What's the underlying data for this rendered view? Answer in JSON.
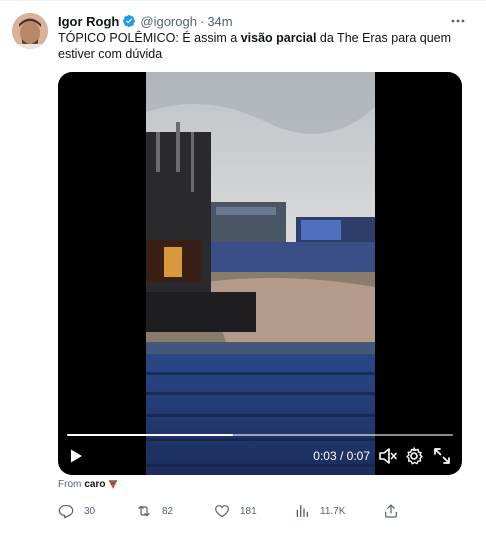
{
  "tweet": {
    "author_name": "Igor Rogh",
    "handle": "@igorogh",
    "separator": "·",
    "time": "34m",
    "text_before": "TÓPICO POLÊMICO: É assim a ",
    "text_bold": "visão parcial",
    "text_after": " da The Eras para quem estiver com dúvida"
  },
  "video": {
    "time_display": "0:03 / 0:07",
    "progress": 0.43,
    "play_icon": "play-icon",
    "mute_icon": "mute-icon",
    "settings_icon": "gear-icon",
    "fullscreen_icon": "fullscreen-icon"
  },
  "source": {
    "label": "From",
    "app": "caro",
    "app_icon": "watermelon-icon"
  },
  "actions": {
    "replies": "30",
    "retweets": "82",
    "likes": "181",
    "views": "11.7K"
  },
  "colors": {
    "verified": "#1d9bf0",
    "secondary_text": "#536471",
    "primary_text": "#0f1419"
  }
}
